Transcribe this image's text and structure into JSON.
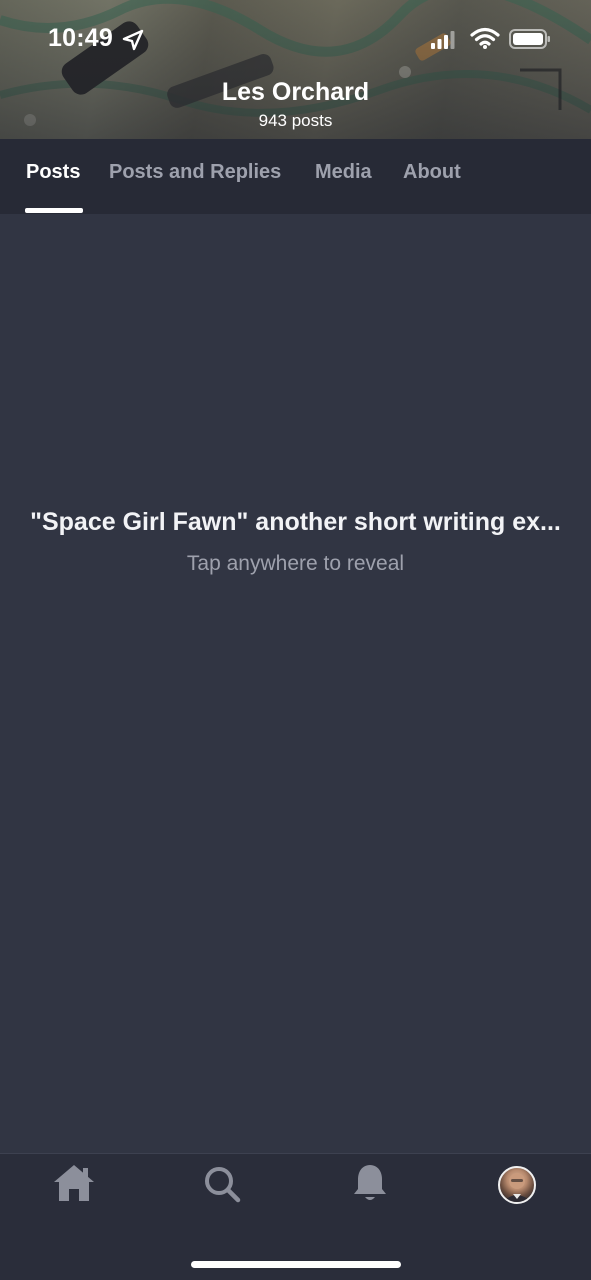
{
  "status_bar": {
    "time": "10:49",
    "icons": [
      "location-arrow-icon",
      "cellular-signal-icon",
      "wifi-icon",
      "battery-icon"
    ]
  },
  "profile": {
    "name": "Les Orchard",
    "post_count": "943 posts"
  },
  "tabs": [
    {
      "label": "Posts",
      "active": true
    },
    {
      "label": "Posts and Replies",
      "active": false
    },
    {
      "label": "Media",
      "active": false
    },
    {
      "label": "About",
      "active": false
    }
  ],
  "content": {
    "hidden_post_title": "\"Space Girl Fawn\" another short writing ex...",
    "reveal_hint": "Tap anywhere to reveal"
  },
  "bottom_nav": {
    "items": [
      "home-icon",
      "search-icon",
      "bell-icon",
      "avatar"
    ]
  },
  "colors": {
    "background": "#313543",
    "tab_bar": "#272a36",
    "active_tab": "#ffffff",
    "inactive_tab": "#9ea1ad"
  }
}
